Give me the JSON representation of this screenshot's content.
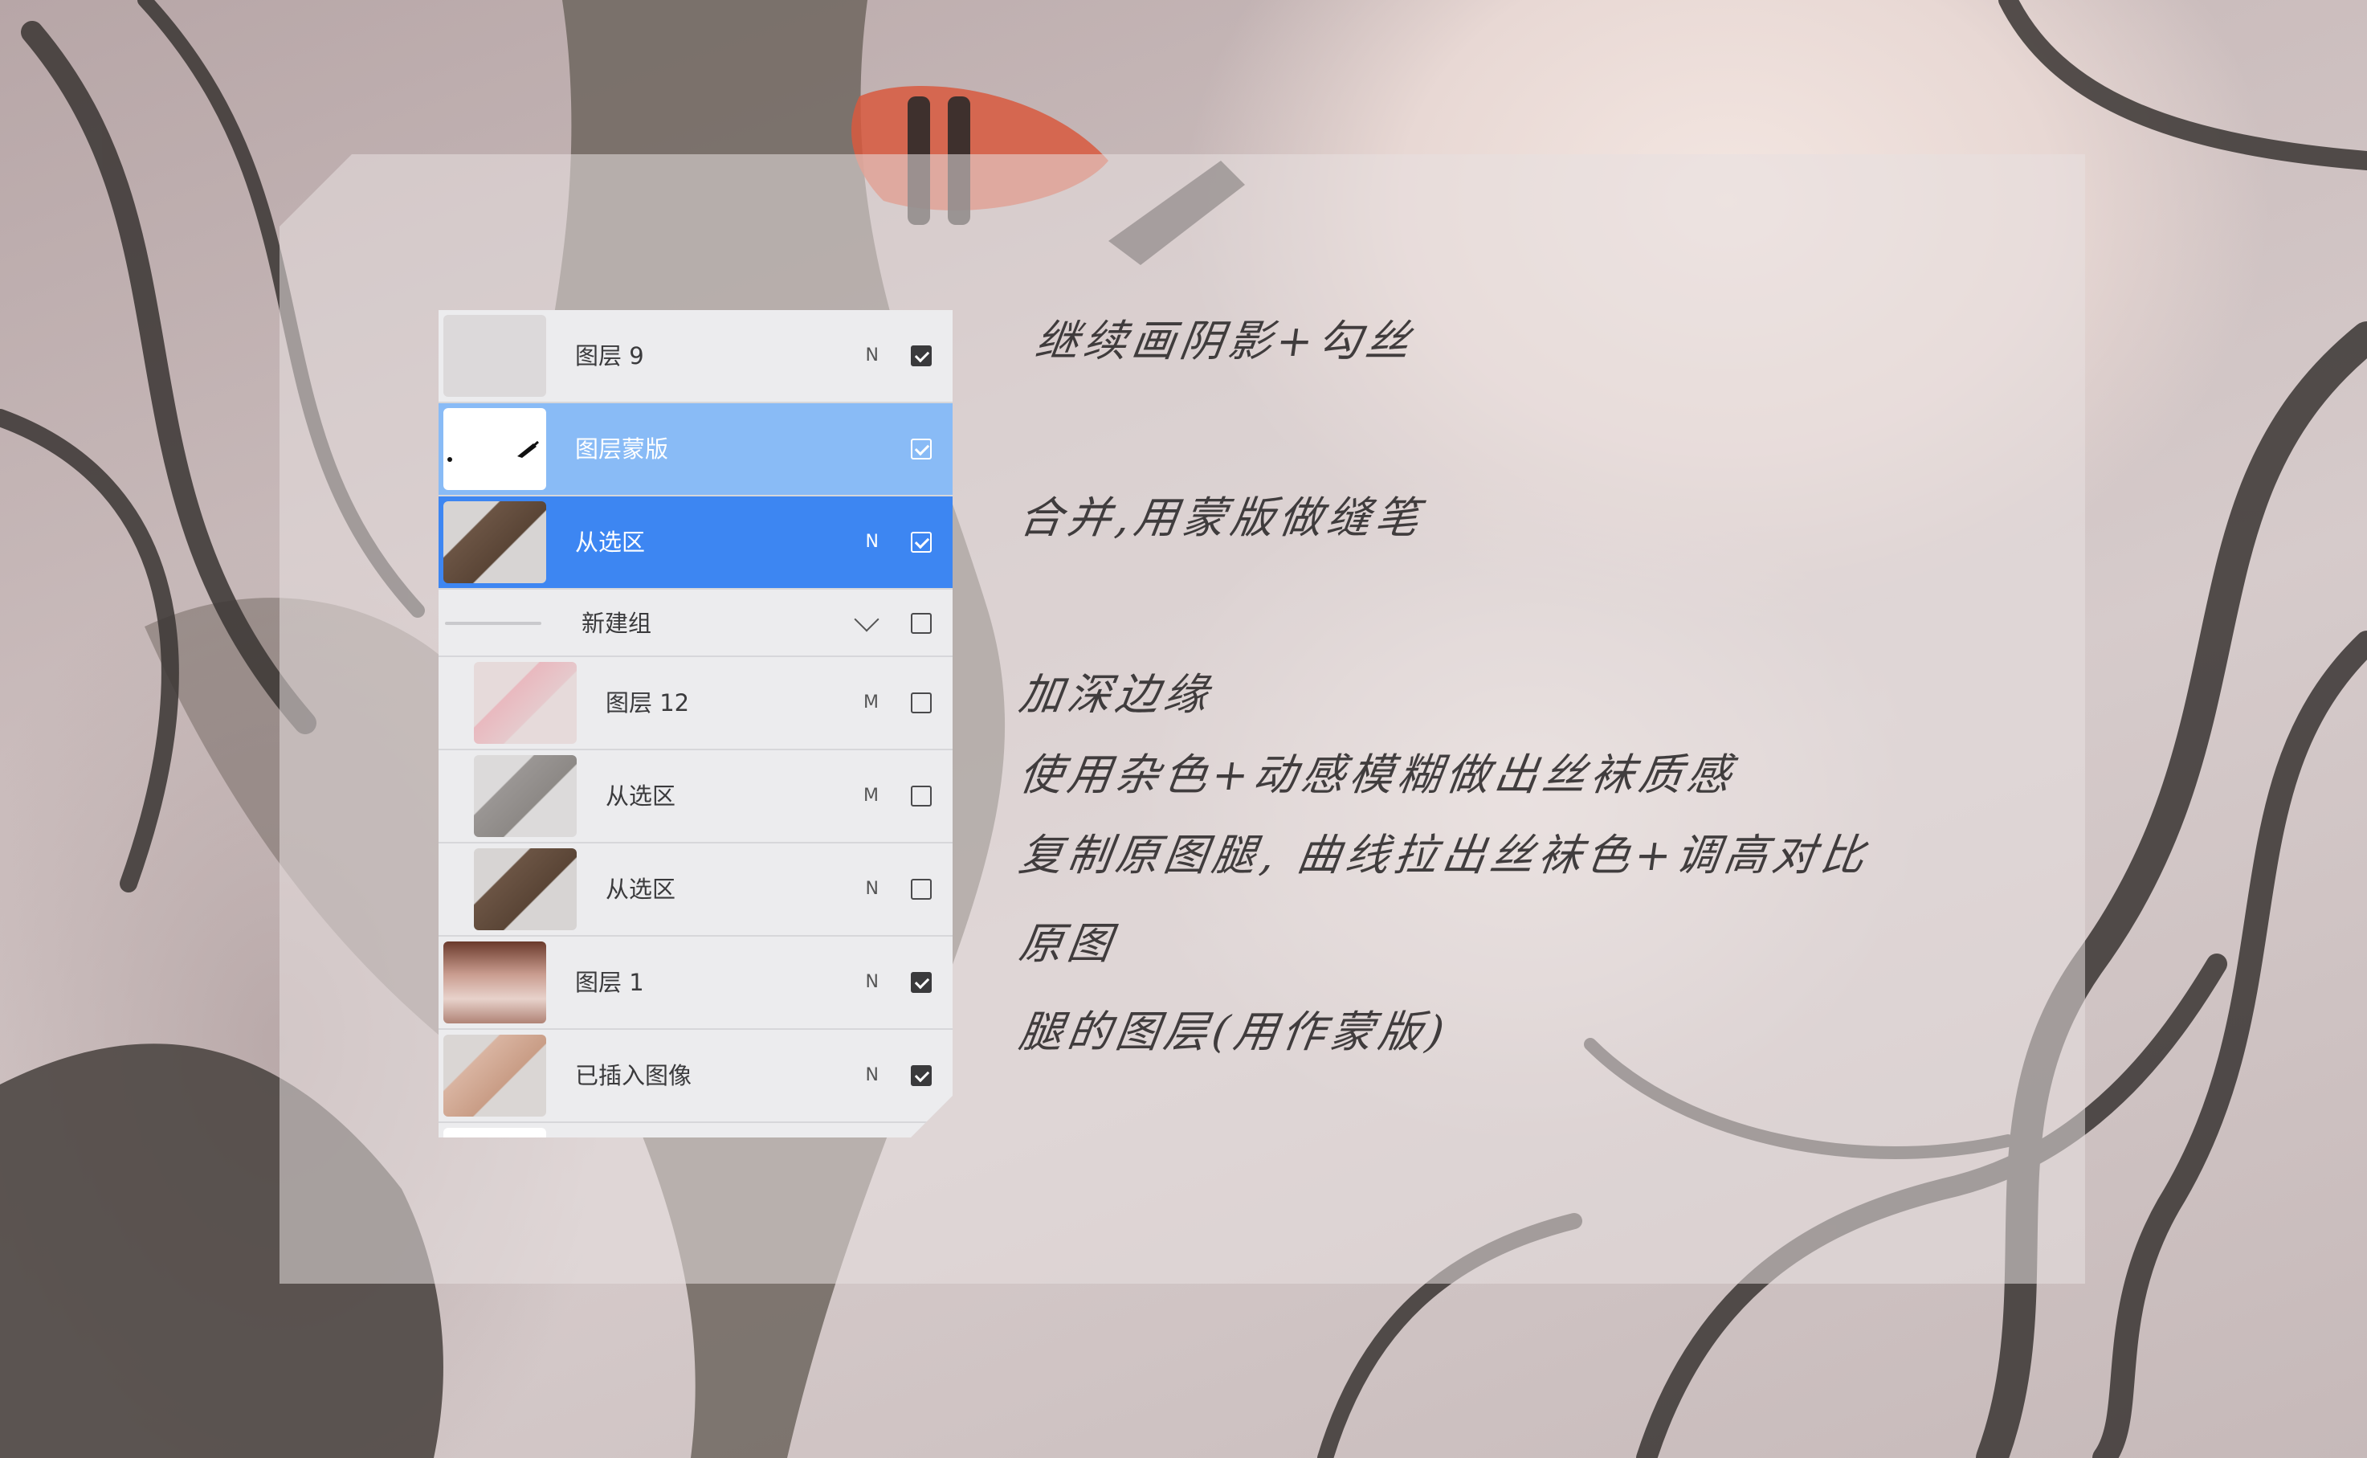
{
  "layers_panel": {
    "layers": [
      {
        "name": "图层 9",
        "mode": "N",
        "visible": true,
        "selection": "none",
        "kind": "layer",
        "indent": false,
        "thumb": "light"
      },
      {
        "name": "图层蒙版",
        "mode": "",
        "visible": true,
        "selection": "light",
        "kind": "mask",
        "indent": false,
        "thumb": "mask"
      },
      {
        "name": "从选区",
        "mode": "N",
        "visible": true,
        "selection": "dark",
        "kind": "layer",
        "indent": false,
        "thumb": "legs-dark"
      },
      {
        "name": "新建组",
        "mode": "",
        "visible": false,
        "selection": "none",
        "kind": "group",
        "indent": false,
        "thumb": "group"
      },
      {
        "name": "图层 12",
        "mode": "M",
        "visible": false,
        "selection": "none",
        "kind": "layer",
        "indent": true,
        "thumb": "legs-pink"
      },
      {
        "name": "从选区",
        "mode": "M",
        "visible": false,
        "selection": "none",
        "kind": "layer",
        "indent": true,
        "thumb": "legs-grey"
      },
      {
        "name": "从选区",
        "mode": "N",
        "visible": false,
        "selection": "none",
        "kind": "layer",
        "indent": true,
        "thumb": "legs-dark"
      },
      {
        "name": "图层 1",
        "mode": "N",
        "visible": true,
        "selection": "none",
        "kind": "layer",
        "indent": false,
        "thumb": "figure"
      },
      {
        "name": "已插入图像",
        "mode": "N",
        "visible": true,
        "selection": "none",
        "kind": "layer",
        "indent": false,
        "thumb": "legs-skin"
      }
    ]
  },
  "notes": [
    "继续画阴影+勾丝",
    "合并,用蒙版做缝笔",
    "加深边缘",
    "使用杂色+动感模糊做出丝袜质感",
    "复制原图腿, 曲线拉出丝袜色+调高对比",
    "原图",
    "腿的图层(用作蒙版)"
  ],
  "colors": {
    "selection_light": "#89bbf6",
    "selection_dark": "#3d86f2",
    "panel_bg": "#ececee"
  }
}
